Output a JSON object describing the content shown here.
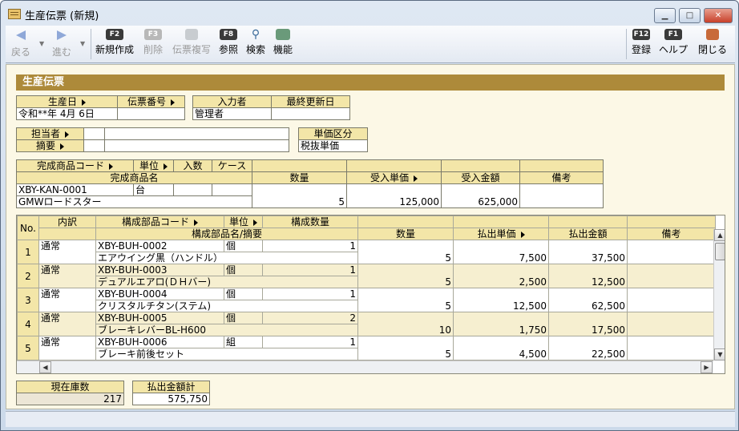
{
  "window": {
    "title": "生産伝票 (新規)"
  },
  "toolbar": {
    "back": "戻る",
    "forward": "進む",
    "new_key": "F2",
    "new": "新規作成",
    "delete_key": "F3",
    "delete": "削除",
    "copy": "伝票複写",
    "ref_key": "F8",
    "ref": "参照",
    "search": "検索",
    "func": "機能",
    "register_key": "F12",
    "register": "登録",
    "help_key": "F1",
    "help": "ヘルプ",
    "close": "閉じる"
  },
  "section_title": "生産伝票",
  "header": {
    "date_label": "生産日",
    "slip_no_label": "伝票番号",
    "inputter_label": "入力者",
    "updated_label": "最終更新日",
    "date_value": "令和**年 4月 6日",
    "slip_no_value": "",
    "inputter_value": "管理者",
    "updated_value": ""
  },
  "person": {
    "staff_label": "担当者",
    "summary_label": "摘要",
    "price_type_label": "単価区分",
    "price_type_value": "税抜単価"
  },
  "product": {
    "code_label": "完成商品コード",
    "unit_label": "単位",
    "qty_per_label": "入数",
    "case_label": "ケース",
    "name_label": "完成商品名",
    "qty_label": "数量",
    "price_label": "受入単価",
    "amount_label": "受入金額",
    "note_label": "備考",
    "code": "XBY-KAN-0001",
    "unit": "台",
    "name": "GMWロードスター",
    "qty": "5",
    "price": "125,000",
    "amount": "625,000"
  },
  "grid": {
    "headers": {
      "no": "No.",
      "breakdown": "内訳",
      "part_code": "構成部品コード",
      "unit": "単位",
      "comp_qty": "構成数量",
      "part_name": "構成部品名/摘要",
      "qty": "数量",
      "out_price": "払出単価",
      "out_amount": "払出金額",
      "note": "備考"
    },
    "rows": [
      {
        "no": "1",
        "breakdown": "通常",
        "code": "XBY-BUH-0002",
        "unit": "個",
        "comp_qty": "1",
        "name": "エアウイング黒（ハンドル）",
        "qty": "5",
        "price": "7,500",
        "amount": "37,500"
      },
      {
        "no": "2",
        "breakdown": "通常",
        "code": "XBY-BUH-0003",
        "unit": "個",
        "comp_qty": "1",
        "name": "デュアルエアロ(ＤＨバー)",
        "qty": "5",
        "price": "2,500",
        "amount": "12,500"
      },
      {
        "no": "3",
        "breakdown": "通常",
        "code": "XBY-BUH-0004",
        "unit": "個",
        "comp_qty": "1",
        "name": "クリスタルチタン(ステム)",
        "qty": "5",
        "price": "12,500",
        "amount": "62,500"
      },
      {
        "no": "4",
        "breakdown": "通常",
        "code": "XBY-BUH-0005",
        "unit": "個",
        "comp_qty": "2",
        "name": "ブレーキレバーBL-H600",
        "qty": "10",
        "price": "1,750",
        "amount": "17,500"
      },
      {
        "no": "5",
        "breakdown": "通常",
        "code": "XBY-BUH-0006",
        "unit": "組",
        "comp_qty": "1",
        "name": "ブレーキ前後セット",
        "qty": "5",
        "price": "4,500",
        "amount": "22,500"
      }
    ]
  },
  "footer": {
    "stock_label": "現在庫数",
    "stock_value": "217",
    "total_label": "払出金額計",
    "total_value": "575,750"
  }
}
